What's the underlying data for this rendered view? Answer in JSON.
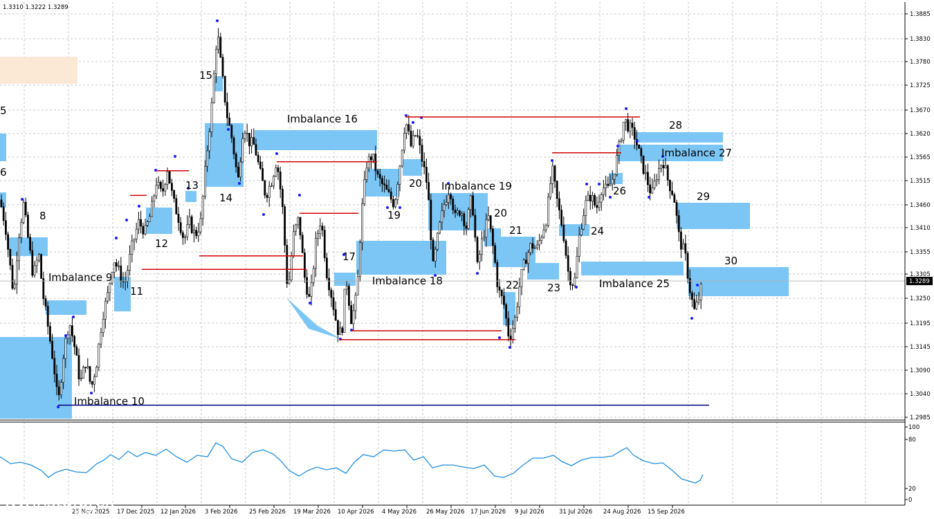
{
  "chart_data": {
    "type": "candlestick",
    "header_quote": "1.3310 1.3222 1.3289",
    "current_price": "1.3289",
    "price_axis": {
      "ticks": [
        "1.3885",
        "1.3830",
        "1.3780",
        "1.3725",
        "1.3670",
        "1.3620",
        "1.3565",
        "1.3515",
        "1.3460",
        "1.3410",
        "1.3355",
        "1.3305",
        "1.3250",
        "1.3195",
        "1.3145",
        "1.3090",
        "1.3040",
        "1.2985"
      ],
      "ylim": [
        1.298,
        1.3905
      ]
    },
    "date_axis": {
      "labels": [
        "25 Nov 2025",
        "17 Dec 2025",
        "12 Jan 2026",
        "3 Feb 2026",
        "25 Feb 2026",
        "19 Mar 2026",
        "10 Apr 2026",
        "4 May 2026",
        "26 May 2026",
        "17 Jun 2026",
        "9 Jul 2026",
        "31 Jul 2026",
        "24 Aug 2026",
        "15 Sep 2026"
      ]
    },
    "indicator_axis": {
      "ticks": [
        "100",
        "80",
        "20",
        "0"
      ],
      "ylim": [
        0,
        100
      ]
    },
    "price_path": [
      [
        0,
        1.347
      ],
      [
        8,
        1.341
      ],
      [
        14,
        1.333
      ],
      [
        20,
        1.3255
      ],
      [
        26,
        1.338
      ],
      [
        34,
        1.346
      ],
      [
        40,
        1.339
      ],
      [
        48,
        1.33
      ],
      [
        56,
        1.335
      ],
      [
        62,
        1.326
      ],
      [
        70,
        1.318
      ],
      [
        78,
        1.31
      ],
      [
        84,
        1.301
      ],
      [
        92,
        1.313
      ],
      [
        100,
        1.32
      ],
      [
        108,
        1.314
      ],
      [
        116,
        1.306
      ],
      [
        124,
        1.311
      ],
      [
        132,
        1.305
      ],
      [
        140,
        1.311
      ],
      [
        148,
        1.321
      ],
      [
        156,
        1.326
      ],
      [
        164,
        1.334
      ],
      [
        172,
        1.331
      ],
      [
        180,
        1.328
      ],
      [
        190,
        1.336
      ],
      [
        200,
        1.342
      ],
      [
        210,
        1.34
      ],
      [
        218,
        1.344
      ],
      [
        226,
        1.351
      ],
      [
        234,
        1.348
      ],
      [
        242,
        1.354
      ],
      [
        250,
        1.347
      ],
      [
        258,
        1.343
      ],
      [
        266,
        1.338
      ],
      [
        274,
        1.342
      ],
      [
        282,
        1.339
      ],
      [
        290,
        1.342
      ],
      [
        298,
        1.356
      ],
      [
        306,
        1.368
      ],
      [
        314,
        1.385
      ],
      [
        320,
        1.376
      ],
      [
        328,
        1.366
      ],
      [
        336,
        1.36
      ],
      [
        344,
        1.351
      ],
      [
        352,
        1.364
      ],
      [
        360,
        1.36
      ],
      [
        368,
        1.359
      ],
      [
        376,
        1.353
      ],
      [
        384,
        1.348
      ],
      [
        392,
        1.351
      ],
      [
        400,
        1.356
      ],
      [
        408,
        1.346
      ],
      [
        416,
        1.326
      ],
      [
        424,
        1.339
      ],
      [
        432,
        1.343
      ],
      [
        440,
        1.33
      ],
      [
        448,
        1.324
      ],
      [
        456,
        1.337
      ],
      [
        464,
        1.343
      ],
      [
        472,
        1.331
      ],
      [
        480,
        1.325
      ],
      [
        488,
        1.318
      ],
      [
        494,
        1.317
      ],
      [
        500,
        1.33
      ],
      [
        508,
        1.32
      ],
      [
        516,
        1.326
      ],
      [
        522,
        1.343
      ],
      [
        530,
        1.355
      ],
      [
        538,
        1.357
      ],
      [
        546,
        1.352
      ],
      [
        554,
        1.35
      ],
      [
        562,
        1.348
      ],
      [
        570,
        1.346
      ],
      [
        578,
        1.355
      ],
      [
        586,
        1.365
      ],
      [
        594,
        1.359
      ],
      [
        602,
        1.362
      ],
      [
        610,
        1.356
      ],
      [
        618,
        1.35
      ],
      [
        626,
        1.332
      ],
      [
        634,
        1.34
      ],
      [
        642,
        1.346
      ],
      [
        650,
        1.35
      ],
      [
        658,
        1.343
      ],
      [
        666,
        1.345
      ],
      [
        674,
        1.341
      ],
      [
        682,
        1.348
      ],
      [
        690,
        1.332
      ],
      [
        698,
        1.339
      ],
      [
        706,
        1.343
      ],
      [
        714,
        1.335
      ],
      [
        720,
        1.327
      ],
      [
        728,
        1.324
      ],
      [
        736,
        1.316
      ],
      [
        744,
        1.32
      ],
      [
        752,
        1.329
      ],
      [
        760,
        1.334
      ],
      [
        768,
        1.337
      ],
      [
        776,
        1.336
      ],
      [
        784,
        1.34
      ],
      [
        790,
        1.343
      ],
      [
        798,
        1.354
      ],
      [
        806,
        1.346
      ],
      [
        814,
        1.34
      ],
      [
        822,
        1.33
      ],
      [
        830,
        1.328
      ],
      [
        838,
        1.34
      ],
      [
        846,
        1.346
      ],
      [
        854,
        1.348
      ],
      [
        862,
        1.345
      ],
      [
        870,
        1.35
      ],
      [
        878,
        1.349
      ],
      [
        886,
        1.352
      ],
      [
        894,
        1.358
      ],
      [
        902,
        1.365
      ],
      [
        910,
        1.363
      ],
      [
        918,
        1.361
      ],
      [
        926,
        1.356
      ],
      [
        934,
        1.352
      ],
      [
        942,
        1.348
      ],
      [
        950,
        1.353
      ],
      [
        958,
        1.356
      ],
      [
        966,
        1.351
      ],
      [
        974,
        1.348
      ],
      [
        982,
        1.338
      ],
      [
        990,
        1.335
      ],
      [
        998,
        1.326
      ],
      [
        1004,
        1.322
      ],
      [
        1010,
        1.325
      ],
      [
        1016,
        1.3289
      ]
    ],
    "indicator_path": [
      [
        0,
        660
      ],
      [
        15,
        670
      ],
      [
        30,
        668
      ],
      [
        45,
        672
      ],
      [
        60,
        680
      ],
      [
        70,
        690
      ],
      [
        80,
        683
      ],
      [
        95,
        678
      ],
      [
        110,
        682
      ],
      [
        125,
        683
      ],
      [
        140,
        670
      ],
      [
        150,
        665
      ],
      [
        160,
        657
      ],
      [
        172,
        664
      ],
      [
        185,
        652
      ],
      [
        198,
        660
      ],
      [
        210,
        654
      ],
      [
        225,
        658
      ],
      [
        240,
        649
      ],
      [
        255,
        660
      ],
      [
        270,
        668
      ],
      [
        285,
        658
      ],
      [
        300,
        660
      ],
      [
        312,
        640
      ],
      [
        322,
        645
      ],
      [
        335,
        663
      ],
      [
        350,
        668
      ],
      [
        365,
        654
      ],
      [
        380,
        650
      ],
      [
        395,
        656
      ],
      [
        405,
        665
      ],
      [
        418,
        680
      ],
      [
        432,
        688
      ],
      [
        445,
        680
      ],
      [
        458,
        675
      ],
      [
        472,
        679
      ],
      [
        486,
        676
      ],
      [
        500,
        684
      ],
      [
        512,
        668
      ],
      [
        525,
        657
      ],
      [
        540,
        660
      ],
      [
        555,
        650
      ],
      [
        570,
        652
      ],
      [
        585,
        650
      ],
      [
        598,
        665
      ],
      [
        612,
        660
      ],
      [
        625,
        676
      ],
      [
        640,
        672
      ],
      [
        655,
        672
      ],
      [
        670,
        675
      ],
      [
        685,
        677
      ],
      [
        700,
        672
      ],
      [
        715,
        688
      ],
      [
        728,
        690
      ],
      [
        742,
        684
      ],
      [
        756,
        672
      ],
      [
        770,
        662
      ],
      [
        785,
        662
      ],
      [
        800,
        658
      ],
      [
        812,
        667
      ],
      [
        826,
        673
      ],
      [
        840,
        665
      ],
      [
        855,
        661
      ],
      [
        870,
        661
      ],
      [
        885,
        659
      ],
      [
        898,
        651
      ],
      [
        906,
        647
      ],
      [
        916,
        658
      ],
      [
        930,
        666
      ],
      [
        945,
        670
      ],
      [
        958,
        669
      ],
      [
        972,
        680
      ],
      [
        985,
        692
      ],
      [
        995,
        695
      ],
      [
        1005,
        698
      ],
      [
        1012,
        694
      ],
      [
        1016,
        686
      ]
    ],
    "zones": [
      {
        "label": "5",
        "color": "#7cc6f5"
      },
      {
        "label": "6",
        "color": "#7cc6f5"
      },
      {
        "label": "8",
        "color": "#7cc6f5"
      },
      {
        "label": "Imbalance 9",
        "color": "#7cc6f5"
      },
      {
        "label": "Imbalance 10",
        "color": "#7cc6f5"
      },
      {
        "label": "11",
        "color": "#7cc6f5"
      },
      {
        "label": "12",
        "color": "#7cc6f5"
      },
      {
        "label": "13",
        "color": "#7cc6f5"
      },
      {
        "label": "14",
        "color": "#7cc6f5"
      },
      {
        "label": "15",
        "color": "#7cc6f5"
      },
      {
        "label": "Imbalance 16",
        "color": "#7cc6f5"
      },
      {
        "label": "17",
        "color": "#7cc6f5"
      },
      {
        "label": "Imbalance 18",
        "color": "#7cc6f5"
      },
      {
        "label": "19",
        "color": "#7cc6f5"
      },
      {
        "label": "Imbalance 19",
        "color": "#7cc6f5"
      },
      {
        "label": "20",
        "color": "#7cc6f5"
      },
      {
        "label": "20",
        "color": "#7cc6f5"
      },
      {
        "label": "21",
        "color": "#7cc6f5"
      },
      {
        "label": "22",
        "color": "#7cc6f5"
      },
      {
        "label": "23",
        "color": "#7cc6f5"
      },
      {
        "label": "24",
        "color": "#7cc6f5"
      },
      {
        "label": "Imbalance 25",
        "color": "#7cc6f5"
      },
      {
        "label": "26",
        "color": "#7cc6f5"
      },
      {
        "label": "Imbalance 27",
        "color": "#7cc6f5"
      },
      {
        "label": "28",
        "color": "#7cc6f5"
      },
      {
        "label": "29",
        "color": "#7cc6f5"
      },
      {
        "label": "30",
        "color": "#7cc6f5"
      }
    ],
    "levels": [
      {
        "price": 1.3655,
        "kind": "resistance",
        "color": "#d00000"
      },
      {
        "price": 1.3555,
        "kind": "resistance",
        "color": "#d00000"
      },
      {
        "price": 1.3575,
        "kind": "resistance",
        "color": "#d00000"
      },
      {
        "price": 1.3535,
        "kind": "resistance",
        "color": "#d00000"
      },
      {
        "price": 1.344,
        "kind": "resistance",
        "color": "#d00000"
      },
      {
        "price": 1.348,
        "kind": "resistance",
        "color": "#d00000"
      },
      {
        "price": 1.3345,
        "kind": "resistance",
        "color": "#d00000"
      },
      {
        "price": 1.3315,
        "kind": "support",
        "color": "#d00000"
      },
      {
        "price": 1.3178,
        "kind": "support",
        "color": "#d00000"
      },
      {
        "price": 1.3158,
        "kind": "support",
        "color": "#d00000"
      },
      {
        "price": 1.3012,
        "kind": "support",
        "color": "#000080"
      }
    ],
    "colors": {
      "zone": "#7cc6f5",
      "level": "#d00000",
      "blue_level": "#000080",
      "candle": "#000000",
      "indicator": "#1f8fe0",
      "highlight": "#fbe9d6"
    },
    "grid": true
  },
  "watermark": {
    "brand": "instaforex",
    "tagline": "Instant Forex Trading"
  }
}
